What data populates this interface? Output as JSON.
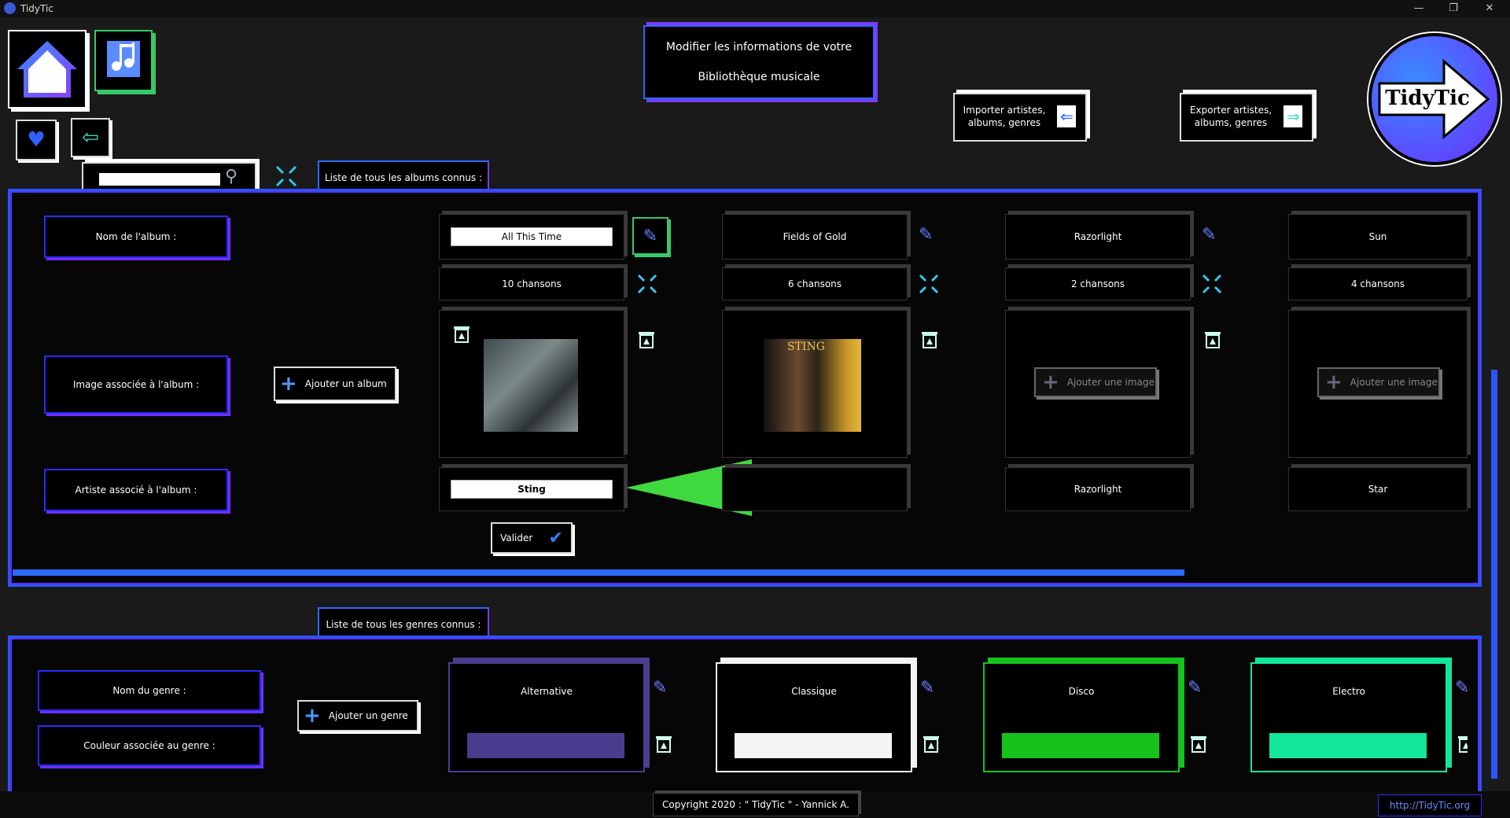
{
  "window": {
    "title": "TidyTic",
    "minimize": "—",
    "restore": "❐",
    "close": "✕"
  },
  "header": {
    "title_line1": "Modifier les informations de votre",
    "title_line2": "Bibliothèque musicale",
    "import_label": "Importer artistes, albums, genres",
    "export_label": "Exporter artistes, albums, genres",
    "logo_text": "TidyTic"
  },
  "search": {
    "placeholder": ""
  },
  "albums": {
    "tab_label": "Liste de tous les albums connus :",
    "row_labels": {
      "name": "Nom de l'album :",
      "image": "Image associée à l'album :",
      "artist": "Artiste associé à l'album :"
    },
    "add_album": "Ajouter un album",
    "add_image": "Ajouter une image",
    "validate": "Valider",
    "items": [
      {
        "name": "All This Time",
        "count": "10 chansons",
        "artist": "Sting"
      },
      {
        "name": "Fields of Gold",
        "count": "6 chansons",
        "artist": ""
      },
      {
        "name": "Razorlight",
        "count": "2 chansons",
        "artist": "Razorlight"
      },
      {
        "name": "Sun",
        "count": "4 chansons",
        "artist": "Star"
      }
    ],
    "cover2_text": "STING"
  },
  "genres": {
    "tab_label": "Liste de tous les genres connus :",
    "name_label": "Nom du genre :",
    "color_label": "Couleur associée au genre :",
    "add_genre": "Ajouter un genre",
    "items": [
      {
        "name": "Alternative",
        "color": "#4a3d8f"
      },
      {
        "name": "Classique",
        "color": "#f4f4f4"
      },
      {
        "name": "Disco",
        "color": "#16c21c"
      },
      {
        "name": "Electro",
        "color": "#12e69a"
      }
    ]
  },
  "footer": {
    "copyright": "Copyright 2020 : \" TidyTic \" - Yannick A.",
    "link": "http://TidyTic.org"
  },
  "colors": {
    "accent_blue": "#2a55ff",
    "accent_purple": "#7a3cff",
    "arrow_green": "#3fd93f"
  }
}
